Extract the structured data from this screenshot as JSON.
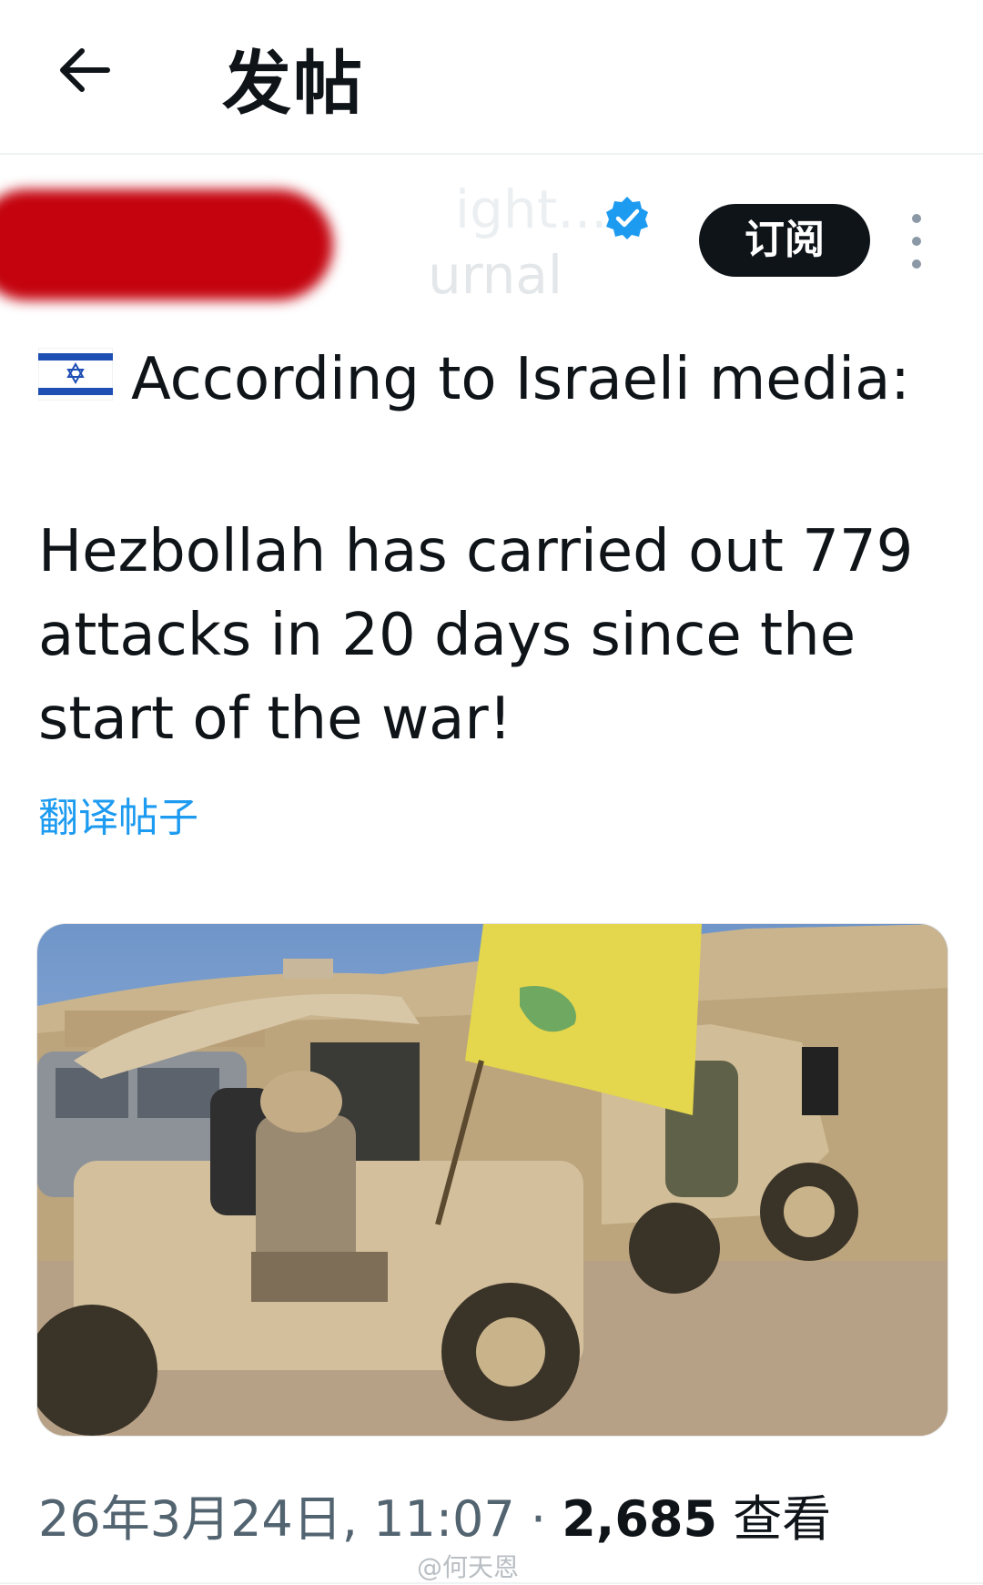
{
  "header": {
    "title": "发帖",
    "back_icon": "arrow-left-icon"
  },
  "author": {
    "name_partial": "ight...",
    "handle_partial": "urnal",
    "verified_icon": "verified-badge-icon",
    "subscribe_label": "订阅",
    "more_icon": "more-vertical-icon"
  },
  "post": {
    "flag_icon": "israel-flag-icon",
    "lead": "According to Israeli media:",
    "body_lines": [
      "Hezbollah has carried out 779",
      "attacks in 20 days since the",
      "start of the war!"
    ],
    "translate_label": "翻译帖子"
  },
  "media": {
    "image": "photo of armed men in tan off-road buggies with a yellow flag"
  },
  "meta": {
    "datetime": "26年3月24日, 11:07",
    "separator": " · ",
    "views_count": "2,685",
    "views_label": " 查看"
  },
  "watermark": "@何天恩",
  "colors": {
    "accent": "#1d9bf0",
    "text": "#0f1419",
    "muted": "#536471",
    "subscribe_bg": "#0f1419",
    "redaction": "#c4030e"
  }
}
